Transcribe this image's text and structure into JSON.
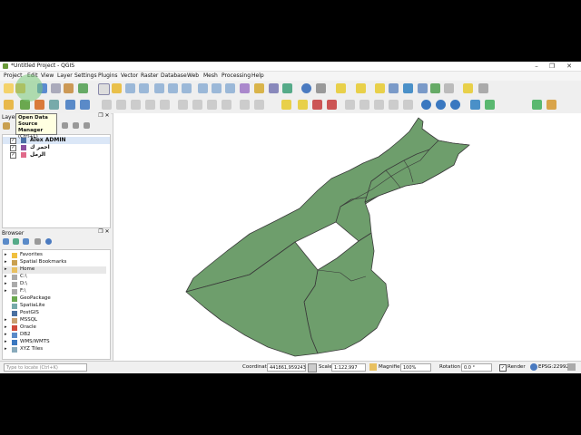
{
  "window": {
    "title": "*Untitled Project - QGIS",
    "minimize": "–",
    "restore": "❐",
    "close": "✕"
  },
  "menu": [
    "Project",
    "Edit",
    "View",
    "Layer",
    "Settings",
    "Plugins",
    "Vector",
    "Raster",
    "Database",
    "Web",
    "Mesh",
    "Processing",
    "Help"
  ],
  "tooltip": {
    "line1": "Open Data",
    "line2": "Source Manager",
    "line3": "(Ctrl+L)"
  },
  "layers_panel": {
    "title": "Layers",
    "items": [
      {
        "name": "Alex ADMIN",
        "color": "#4a6fa5",
        "checked": true
      },
      {
        "name": "احمر ك",
        "color": "#8b4f9f",
        "checked": true
      },
      {
        "name": "الرمل",
        "color": "#e06a8a",
        "checked": true
      }
    ]
  },
  "browser_panel": {
    "title": "Browser",
    "items": [
      {
        "label": "Favorites",
        "icon": "star-icon"
      },
      {
        "label": "Spatial Bookmarks",
        "icon": "bookmark-icon"
      },
      {
        "label": "Home",
        "icon": "folder-icon"
      },
      {
        "label": "C:\\",
        "icon": "drive-icon"
      },
      {
        "label": "D:\\",
        "icon": "drive-icon"
      },
      {
        "label": "F:\\",
        "icon": "drive-icon"
      },
      {
        "label": "GeoPackage",
        "icon": "geopackage-icon"
      },
      {
        "label": "SpatiaLite",
        "icon": "spatialite-icon"
      },
      {
        "label": "PostGIS",
        "icon": "postgis-icon"
      },
      {
        "label": "MSSQL",
        "icon": "mssql-icon"
      },
      {
        "label": "Oracle",
        "icon": "oracle-icon"
      },
      {
        "label": "DB2",
        "icon": "db2-icon"
      },
      {
        "label": "WMS/WMTS",
        "icon": "wms-icon"
      },
      {
        "label": "XYZ Tiles",
        "icon": "xyz-icon"
      }
    ]
  },
  "status": {
    "locate_placeholder": "Type to locate (Ctrl+K)",
    "coordinate_label": "Coordinate",
    "coordinate_value": "441861,959243",
    "scale_label": "Scale",
    "scale_value": "1:122,997",
    "magnifier_label": "Magnifier",
    "magnifier_value": "100%",
    "rotation_label": "Rotation",
    "rotation_value": "0.0 °",
    "render_label": "Render",
    "crs": "EPSG:22992"
  },
  "colors": {
    "map_fill": "#6e9e6c",
    "map_stroke": "#3a3a3a"
  }
}
